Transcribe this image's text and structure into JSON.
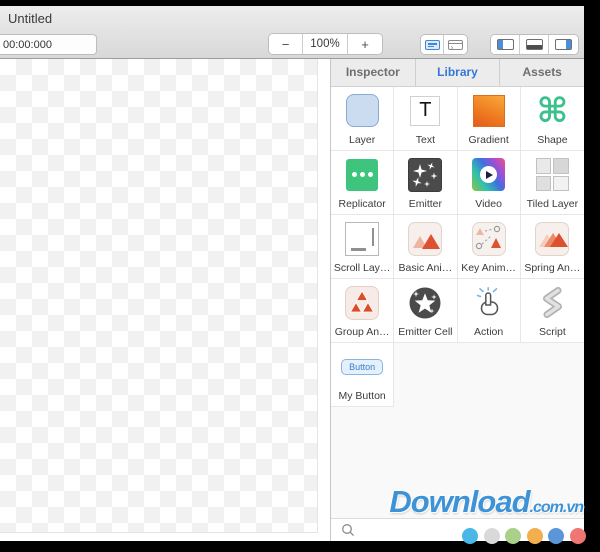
{
  "window": {
    "title": "Untitled"
  },
  "toolbar": {
    "time_value": "00:00:000",
    "zoom_out": "−",
    "zoom_level": "100%",
    "zoom_in": "+"
  },
  "panel_tabs": [
    {
      "label": "Inspector",
      "active": false
    },
    {
      "label": "Library",
      "active": true
    },
    {
      "label": "Assets",
      "active": false
    }
  ],
  "library": {
    "glyphs": {
      "text": "T",
      "shape": "⌘",
      "my_button": "Button"
    },
    "items": [
      {
        "id": "layer",
        "label": "Layer"
      },
      {
        "id": "text",
        "label": "Text"
      },
      {
        "id": "gradient",
        "label": "Gradient"
      },
      {
        "id": "shape",
        "label": "Shape"
      },
      {
        "id": "replicator",
        "label": "Replicator"
      },
      {
        "id": "emitter",
        "label": "Emitter"
      },
      {
        "id": "video",
        "label": "Video"
      },
      {
        "id": "tiled-layer",
        "label": "Tiled Layer"
      },
      {
        "id": "scroll-layer",
        "label": "Scroll Lay…"
      },
      {
        "id": "basic-animation",
        "label": "Basic Ani…"
      },
      {
        "id": "key-animation",
        "label": "Key Anim…"
      },
      {
        "id": "spring-animation",
        "label": "Spring An…"
      },
      {
        "id": "group-animation",
        "label": "Group An…"
      },
      {
        "id": "emitter-cell",
        "label": "Emitter Cell"
      },
      {
        "id": "action",
        "label": "Action"
      },
      {
        "id": "script",
        "label": "Script"
      },
      {
        "id": "my-button",
        "label": "My Button"
      }
    ],
    "search_value": ""
  },
  "watermark": {
    "brand": "Download",
    "suffix": ".com.vn"
  },
  "footer_dots": [
    "#49b8e6",
    "#d9d9d9",
    "#a9d189",
    "#f3ae4e",
    "#5b97d8",
    "#ef7673"
  ],
  "colors": {
    "accent_blue": "#3478d8"
  }
}
